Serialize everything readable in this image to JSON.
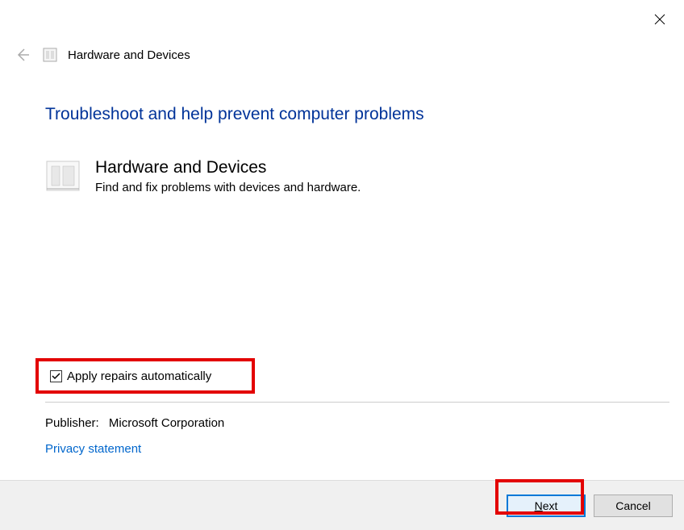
{
  "nav": {
    "title": "Hardware and Devices"
  },
  "heading": "Troubleshoot and help prevent computer problems",
  "section": {
    "title": "Hardware and Devices",
    "description": "Find and fix problems with devices and hardware."
  },
  "checkbox": {
    "label": "Apply repairs automatically",
    "checked": true
  },
  "publisher": {
    "label": "Publisher:",
    "value": "Microsoft Corporation"
  },
  "privacy_link": "Privacy statement",
  "buttons": {
    "next_prefix": "N",
    "next_suffix": "ext",
    "cancel": "Cancel"
  }
}
